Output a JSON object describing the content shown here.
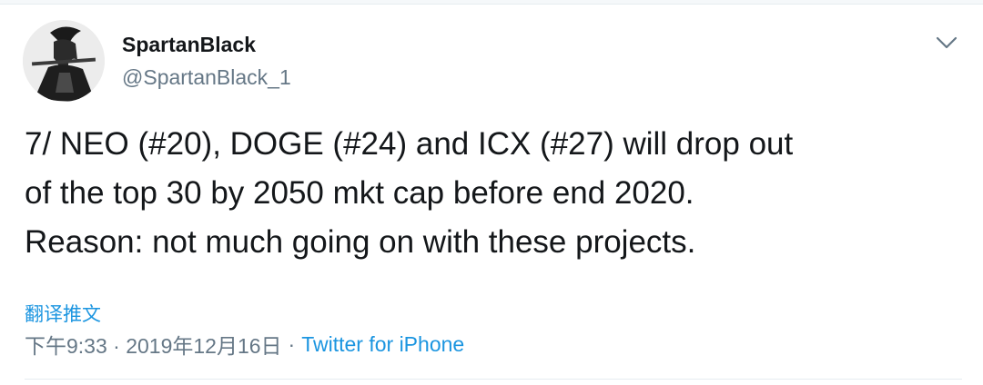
{
  "author": {
    "display_name": "SpartanBlack",
    "handle": "@SpartanBlack_1",
    "avatar_icon": "spartan-warrior-avatar"
  },
  "menu": {
    "icon": "chevron-down-icon"
  },
  "tweet": {
    "lines": [
      "7/ NEO (#20), DOGE (#24) and ICX (#27) will drop out",
      "of the top 30 by 2050 mkt cap before end 2020.",
      "Reason: not much going on with these projects."
    ]
  },
  "translate_label": "翻译推文",
  "meta": {
    "timestamp": "下午9:33 · 2019年12月16日",
    "separator": "·",
    "source": "Twitter for iPhone"
  },
  "colors": {
    "link": "#1b95e0",
    "secondary_text": "#657786",
    "primary_text": "#14171a"
  }
}
